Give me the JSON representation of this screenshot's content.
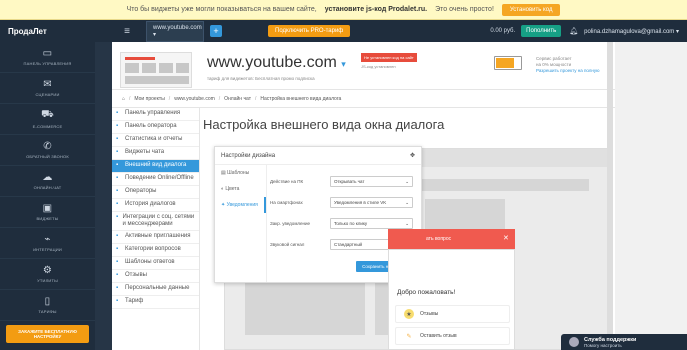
{
  "topbar": {
    "text": "Что бы виджеты уже могли показываться на вашем сайте,",
    "bold": "установите js-код Prodalet.ru.",
    "tail": "Это очень просто!",
    "button": "Установить код"
  },
  "nav": {
    "brand": "ПродаЛет",
    "site": "www.youtube.com",
    "pro": "Подключить PRO-тариф",
    "balance": "0.00 руб.",
    "topup": "Пополнить",
    "email": "polina.dzhamagulova@gmail.com"
  },
  "sidebar": {
    "items": [
      {
        "icon": "monitor-icon",
        "label": "Панель управления"
      },
      {
        "icon": "envelope-icon",
        "label": "Сценарии"
      },
      {
        "icon": "cart-icon",
        "label": "E-commerce"
      },
      {
        "icon": "phone-icon",
        "label": "Обратный звонок"
      },
      {
        "icon": "chat-icon",
        "label": "Онлайн-чат"
      },
      {
        "icon": "image-icon",
        "label": "Виджеты"
      },
      {
        "icon": "plug-icon",
        "label": "Интеграции"
      },
      {
        "icon": "gear-icon",
        "label": "Утилиты"
      },
      {
        "icon": "tablet-icon",
        "label": "Тарифы"
      }
    ],
    "cta": "Закажите бесплатную настройку"
  },
  "header": {
    "domain": "www.youtube.com",
    "tariff": "тариф для видежетов: Бесплатная промо подписка",
    "not_installed": "Не установлен код на сайт",
    "code_installed": "JS-код установлен",
    "right_1": "Сервис работает",
    "right_2": "на 0% мощности",
    "right_link": "Разрешить проекту на полную"
  },
  "breadcrumbs": [
    "Мои проекты",
    "www.youtube.com",
    "Онлайн чат",
    "Настройка внешнего вида диалога"
  ],
  "menu": [
    {
      "label": "Панель управления"
    },
    {
      "label": "Панель оператора"
    },
    {
      "label": "Статистика и отчеты"
    },
    {
      "label": "Виджеты чата"
    },
    {
      "label": "Внешний вид диалога",
      "active": true
    },
    {
      "label": "Поведение Online/Offline"
    },
    {
      "label": "Операторы"
    },
    {
      "label": "История диалогов"
    },
    {
      "label": "Интеграции с соц. сетями и мессенджерами"
    },
    {
      "label": "Активные приглашения"
    },
    {
      "label": "Категории вопросов"
    },
    {
      "label": "Шаблоны ответов"
    },
    {
      "label": "Отзывы"
    },
    {
      "label": "Персональные данные"
    },
    {
      "label": "Тариф"
    }
  ],
  "page_title": "Настройка внешнего вида окна диалога",
  "settings": {
    "title": "Настройки дизайна",
    "tabs": [
      "Шаблоны",
      "Цвета",
      "Уведомления"
    ],
    "rows": [
      {
        "label": "Действие на ПК",
        "value": "Открывать чат"
      },
      {
        "label": "На смартфонах",
        "value": "Уведомления в стиле VK"
      },
      {
        "label": "Закр. уведомление",
        "value": "Только по клику"
      },
      {
        "label": "Звуковой сигнал",
        "value": "Стандартный"
      }
    ],
    "save": "Сохранить настройки"
  },
  "widget": {
    "head": "ать вопрос",
    "welcome": "Добро пожаловать!",
    "options": [
      "Отзывы",
      "Оставить отзыв"
    ]
  },
  "support": {
    "title": "Служба поддержки",
    "subtitle": "Помогу настроить"
  }
}
